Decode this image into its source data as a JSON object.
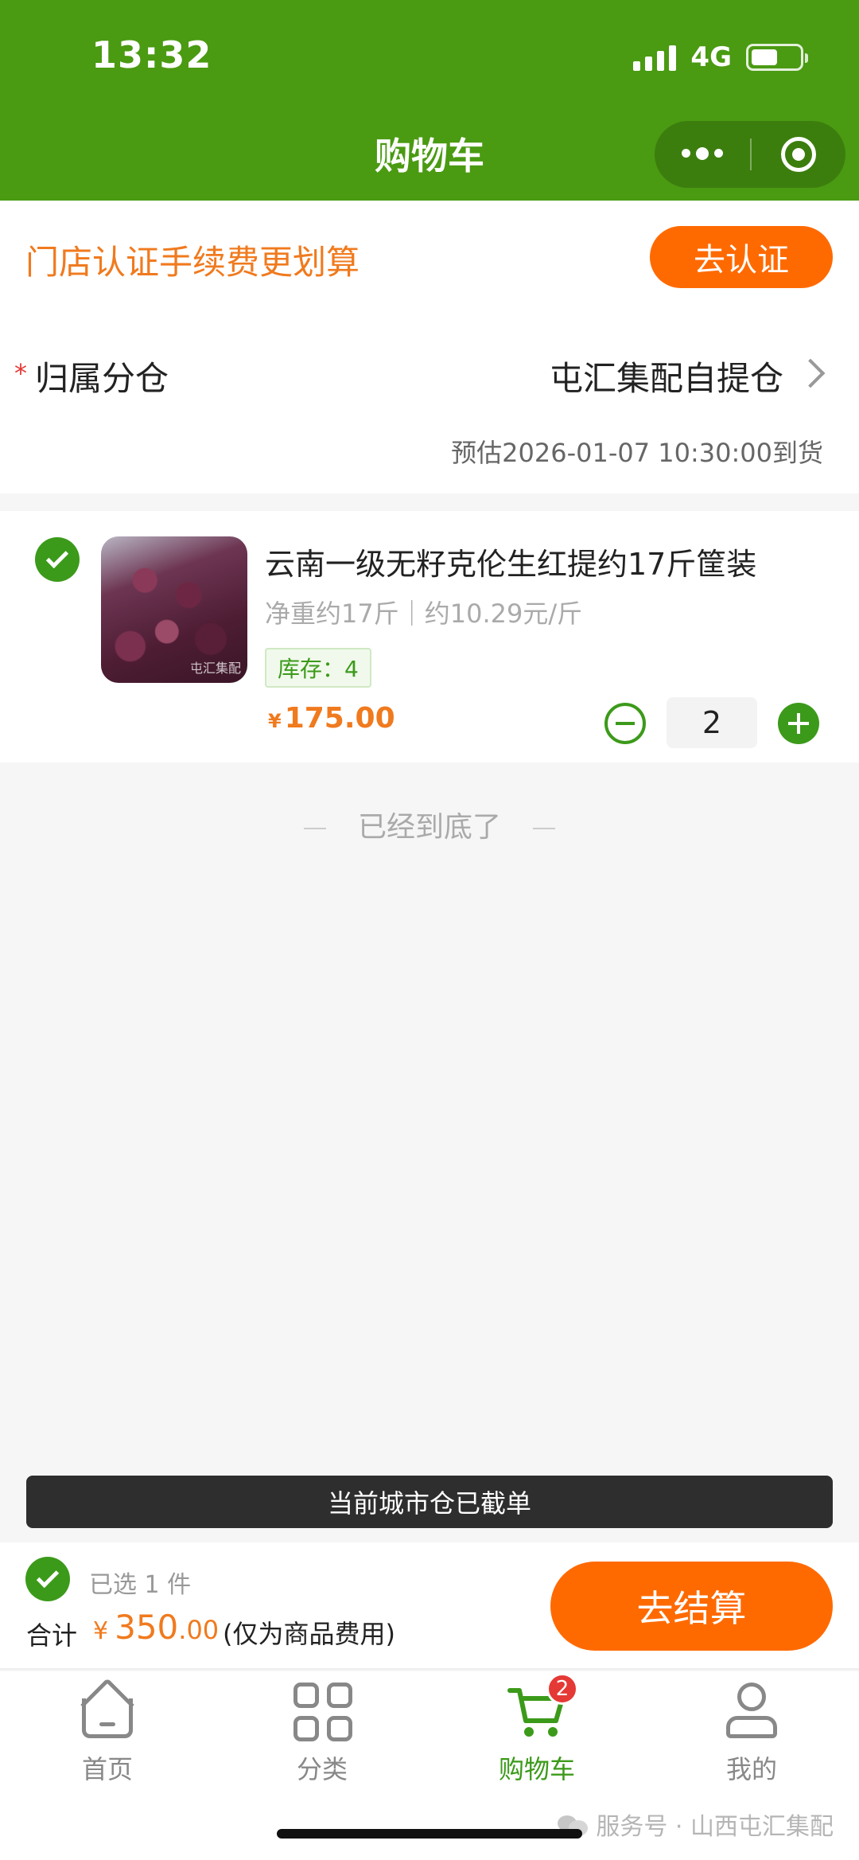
{
  "status_bar": {
    "time": "13:32",
    "network": "4G"
  },
  "header": {
    "title": "购物车"
  },
  "promo": {
    "text": "门店认证手续费更划算",
    "button": "去认证"
  },
  "warehouse": {
    "label": "归属分仓",
    "value": "屯汇集配自提仓",
    "eta": "预估2026-01-07 10:30:00到货"
  },
  "product": {
    "title": "云南一级无籽克伦生红提约17斤筐装",
    "subtitle": "净重约17斤｜约10.29元/斤",
    "stock": "库存：4",
    "price_symbol": "¥",
    "price": "175.00",
    "quantity": "2",
    "image_watermark": "屯汇集配"
  },
  "end_note": "已经到底了",
  "cutoff_notice": "当前城市仓已截单",
  "checkout": {
    "selected": "已选 1 件",
    "total_label": "合计",
    "currency": "¥",
    "total_int": "350",
    "total_cents": ".00",
    "total_note": "(仅为商品费用)",
    "button": "去结算"
  },
  "tabbar": {
    "items": [
      {
        "label": "首页",
        "icon": "home-icon"
      },
      {
        "label": "分类",
        "icon": "grid-icon"
      },
      {
        "label": "购物车",
        "icon": "cart-icon",
        "badge": "2"
      },
      {
        "label": "我的",
        "icon": "user-icon"
      }
    ]
  },
  "footer_source": "服务号 · 山西屯汇集配",
  "colors": {
    "header_green": "#4a9a12",
    "accent_orange": "#ff6a00",
    "check_green": "#3c9a1a",
    "badge_red": "#e53935"
  }
}
